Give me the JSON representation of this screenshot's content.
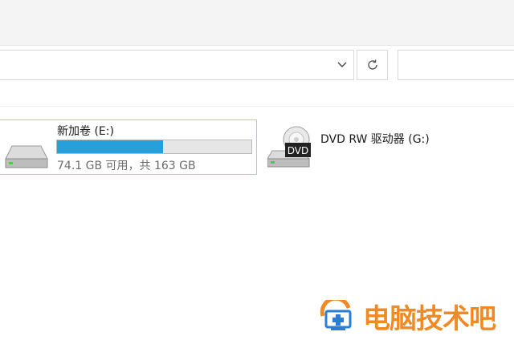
{
  "address_bar": {
    "value": "",
    "dropdown_icon": "chevron-down-icon",
    "refresh_icon": "refresh-icon"
  },
  "search": {
    "placeholder": ""
  },
  "drives": [
    {
      "name": "新加卷 (E:)",
      "space": "74.1 GB 可用，共 163 GB",
      "used_fraction": 0.545,
      "icon": "hard-drive-icon",
      "selected": true
    },
    {
      "name": "DVD RW 驱动器 (G:)",
      "icon": "dvd-drive-icon",
      "icon_label": "DVD"
    }
  ],
  "watermark": {
    "text": "电脑技术吧"
  },
  "colors": {
    "selection_border": "#99d1e8",
    "capacity_fill": "#26a0da",
    "watermark": "#f08a24"
  }
}
